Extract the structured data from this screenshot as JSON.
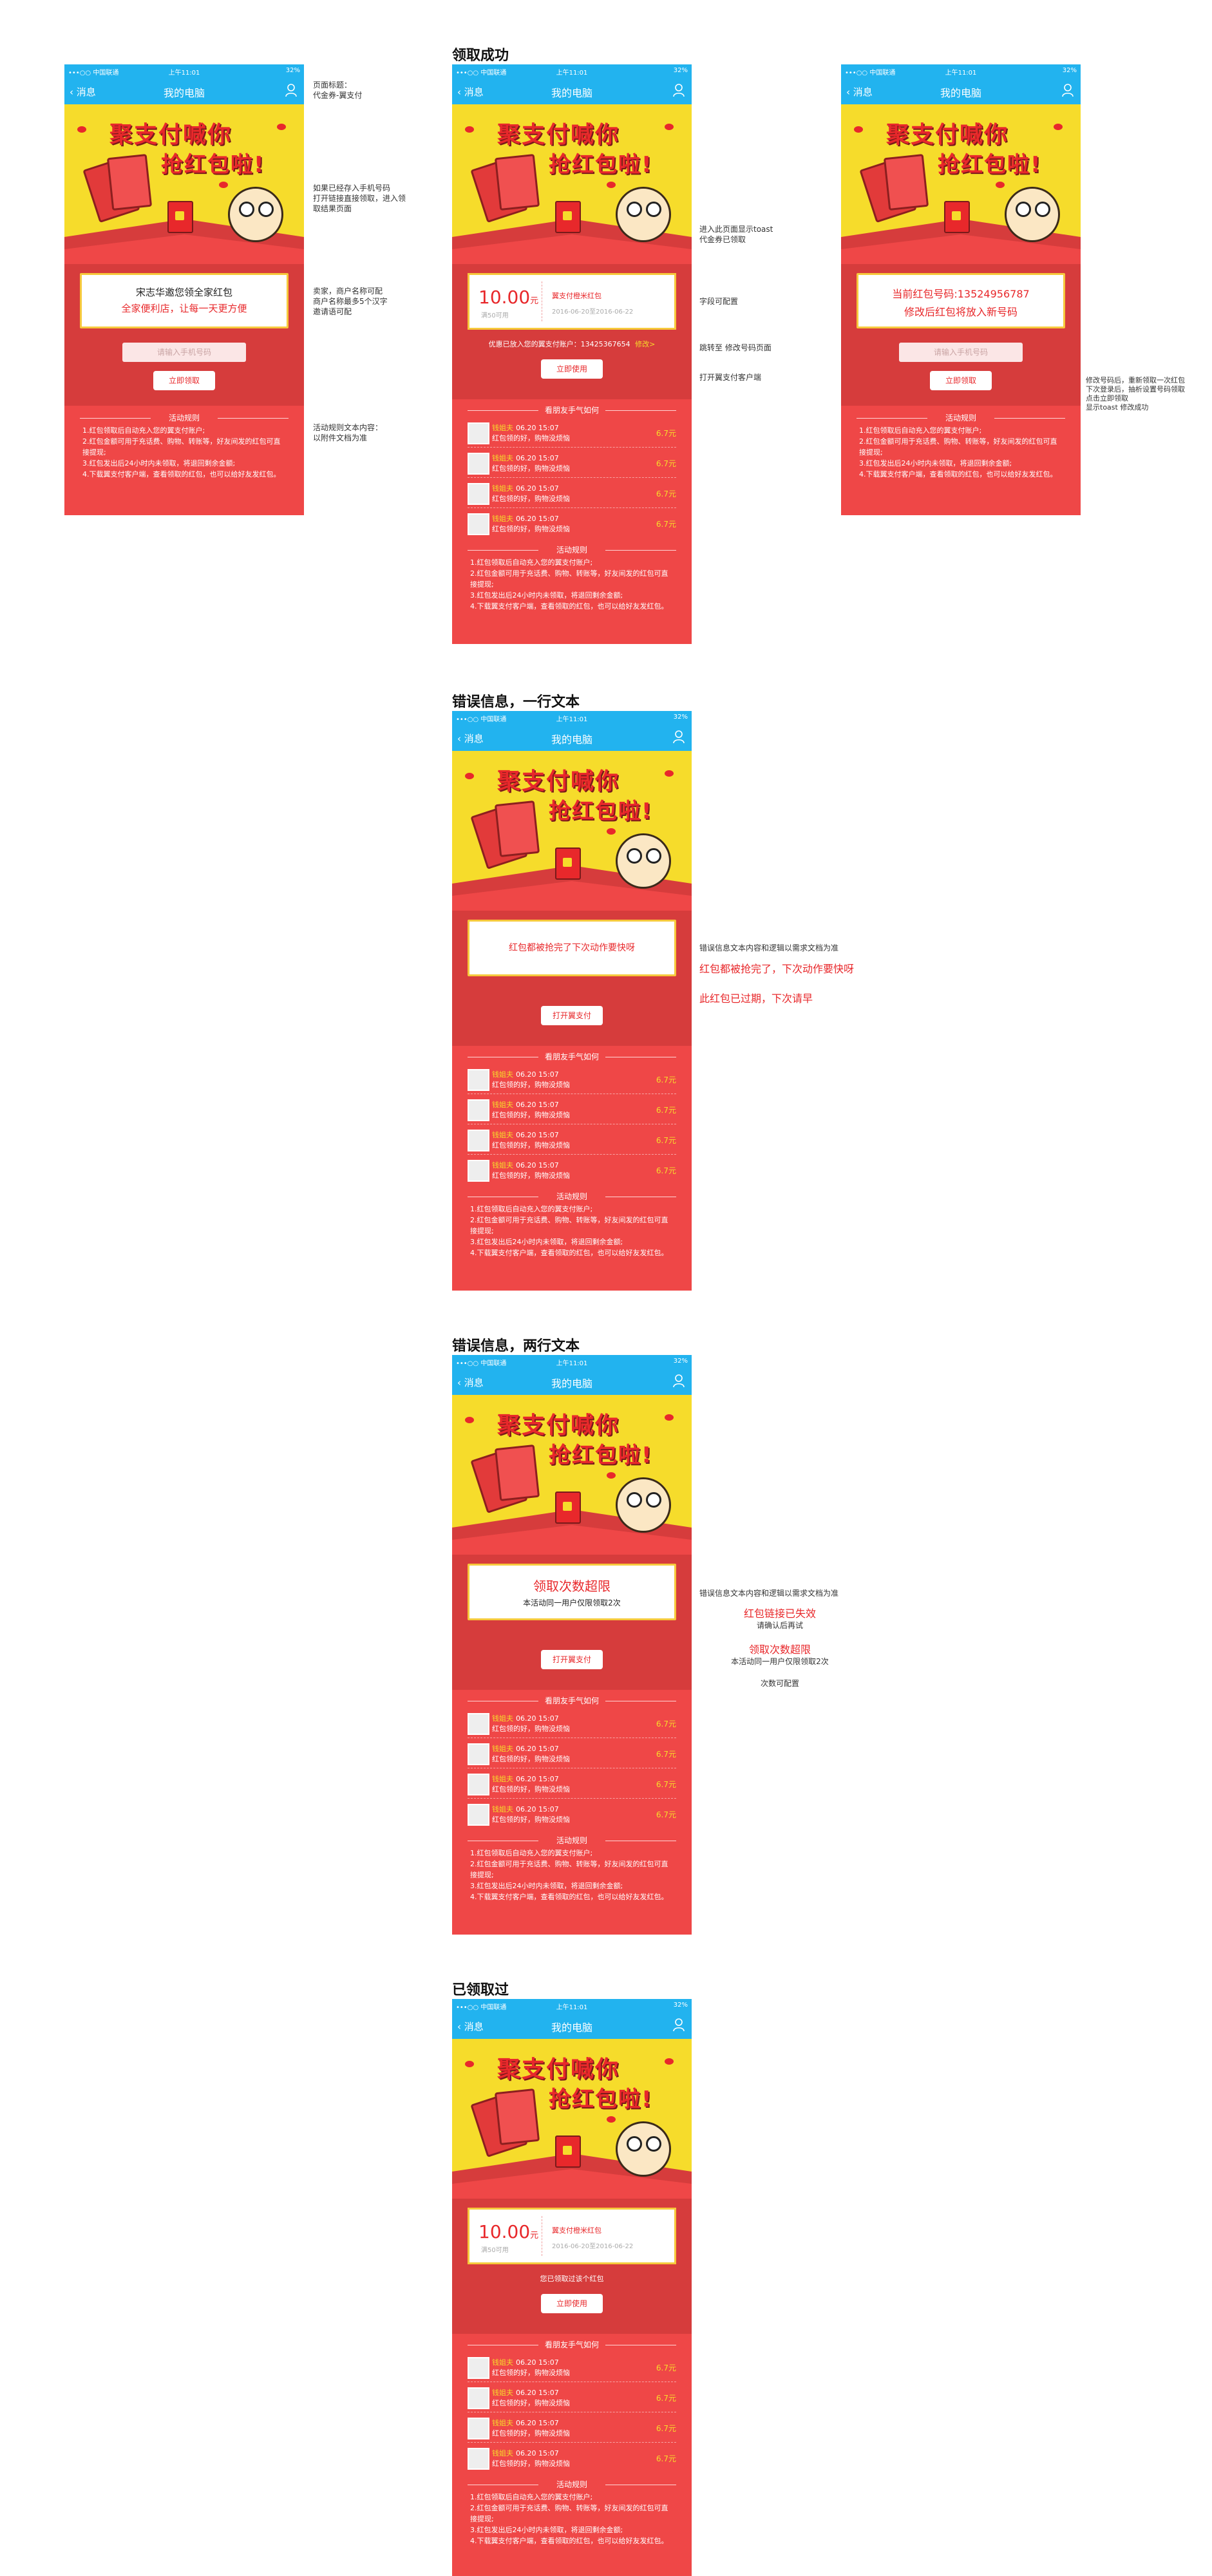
{
  "app": {
    "carrier": "•••○○ 中国联通",
    "time": "上午11:01",
    "battery": "32%",
    "back_label": "消息",
    "title": "我的电脑"
  },
  "banner": {
    "line1": "聚支付喊你",
    "line2": "抢红包啦!"
  },
  "common": {
    "friends_title": "看朋友手气如何",
    "rules_title": "活动规则",
    "rules": [
      "1.红包领取后自动充入您的翼支付账户;",
      "2.红包金额可用于充话费、购物、转账等，好友间发的红包可直接提现;",
      "3.红包发出后24小时内未领取，将退回剩余金额;",
      "4.下载翼支付客户端，查看领取的红包，也可以给好友发红包。"
    ],
    "friends": [
      {
        "name": "钱姐夫",
        "when": "06.20  15:07",
        "msg": "红包领的好，购物没烦恼",
        "amount": "6.7元"
      },
      {
        "name": "钱姐夫",
        "when": "06.20  15:07",
        "msg": "红包领的好，购物没烦恼",
        "amount": "6.7元"
      },
      {
        "name": "钱姐夫",
        "when": "06.20  15:07",
        "msg": "红包领的好，购物没烦恼",
        "amount": "6.7元"
      },
      {
        "name": "钱姐夫",
        "when": "06.20  15:07",
        "msg": "红包领的好，购物没烦恼",
        "amount": "6.7元"
      }
    ],
    "coupon": {
      "value": "10.00",
      "unit": "元",
      "sub": "满50可用",
      "name": "翼支付橙米红包",
      "date": "2016-06-20至2016-06-22"
    }
  },
  "sections": {
    "success": "领取成功",
    "error_one": "错误信息，一行文本",
    "error_two": "错误信息，两行文本",
    "already": "已领取过"
  },
  "screens": {
    "s1": {
      "inviter_line1": "宋志华邀您领全家红包",
      "inviter_line2": "全家便利店，让每一天更方便",
      "phone_placeholder": "请输入手机号码",
      "button": "立即领取"
    },
    "s2": {
      "phone_notice": "优惠已放入您的翼支付账户：13425367654",
      "modify": "修改>",
      "button": "立即使用"
    },
    "s3": {
      "line1": "当前红包号码:13524956787",
      "line2": "修改后红包将放入新号码",
      "phone_placeholder": "请输入手机号码",
      "button": "立即领取"
    },
    "s4": {
      "error": "红包都被抢完了下次动作要快呀",
      "button": "打开翼支付"
    },
    "s5": {
      "error_title": "领取次数超限",
      "error_sub": "本活动同一用户仅限领取2次",
      "button": "打开翼支付"
    },
    "s6": {
      "already": "您已领取过该个红包",
      "button": "立即使用"
    }
  },
  "notes": {
    "n1": "页面标题：\n代金券-翼支付",
    "n2": "如果已经存入手机号码\n打开链接直接领取，进入领\n取结果页面",
    "n3": "卖家，商户名称可配\n商户名称最多5个汉字\n邀请语可配",
    "n4": "活动规则文本内容：\n以附件文档为准",
    "n5": "进入此页面显示toast\n代金券已领取",
    "n6": "字段可配置",
    "n7": "跳转至 修改号码页面",
    "n8": "打开翼支付客户端",
    "n9": "修改号码后，重新领取一次红包\n下次登录后，抽析设置号码领取\n点击立即领取\n显示toast 修改成功",
    "n10": "错误信息文本内容和逻辑以需求文档为准",
    "n11": "红包都被抢完了，下次动作要快呀",
    "n12": "此红包已过期，下次请早",
    "n13": "错误信息文本内容和逻辑以需求文档为准",
    "n14": "红包链接已失效",
    "n15": "请确认后再试",
    "n16": "领取次数超限",
    "n17": "本活动同一用户仅限领取2次",
    "n18": "次数可配置"
  }
}
